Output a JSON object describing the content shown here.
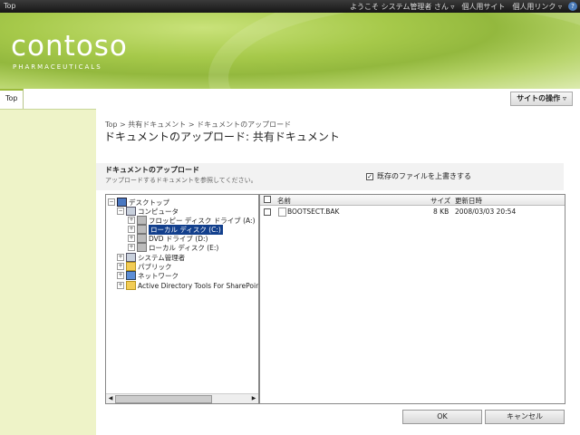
{
  "topbar": {
    "site": "Top",
    "welcome": "ようこそ システム管理者 さん ▿",
    "mysite": "個人用サイト",
    "mylinks": "個人用リンク ▿",
    "help": "?"
  },
  "brand": {
    "logo": "contoso",
    "tagline": "PHARMACEUTICALS"
  },
  "tabs": [
    {
      "label": "Top"
    }
  ],
  "site_actions": "サイトの操作 ▿",
  "breadcrumb": "Top > 共有ドキュメント > ドキュメントのアップロード",
  "page_title": "ドキュメントのアップロード: 共有ドキュメント",
  "upload": {
    "heading": "ドキュメントのアップロード",
    "description": "アップロードするドキュメントを参照してください。",
    "overwrite_label": "既存のファイルを上書きする",
    "overwrite_checked": true
  },
  "tree": {
    "items": [
      {
        "label": "デスクトップ",
        "icon": "desktop-icon",
        "expander": "−"
      },
      {
        "label": "コンピュータ",
        "icon": "computer-icon",
        "expander": "−"
      },
      {
        "label": "フロッピー ディスク ドライブ (A:)",
        "icon": "floppy-drive-icon",
        "expander": "+"
      },
      {
        "label": "ローカル ディスク (C:)",
        "icon": "local-disk-icon",
        "expander": "+",
        "selected": true
      },
      {
        "label": "DVD ドライブ (D:)",
        "icon": "dvd-drive-icon",
        "expander": "+"
      },
      {
        "label": "ローカル ディスク (E:)",
        "icon": "local-disk-icon",
        "expander": "+"
      },
      {
        "label": "システム管理者",
        "icon": "user-folder-icon",
        "expander": "+"
      },
      {
        "label": "パブリック",
        "icon": "folder-icon",
        "expander": "+"
      },
      {
        "label": "ネットワーク",
        "icon": "network-icon",
        "expander": "+"
      },
      {
        "label": "Active Directory Tools For SharePoint",
        "icon": "folder-icon",
        "expander": "+"
      }
    ]
  },
  "files": {
    "columns": {
      "name": "名前",
      "size": "サイズ",
      "modified": "更新日時"
    },
    "rows": [
      {
        "name": "BOOTSECT.BAK",
        "size": "8 KB",
        "modified": "2008/03/03 20:54"
      }
    ]
  },
  "buttons": {
    "ok": "OK",
    "cancel": "キャンセル"
  }
}
